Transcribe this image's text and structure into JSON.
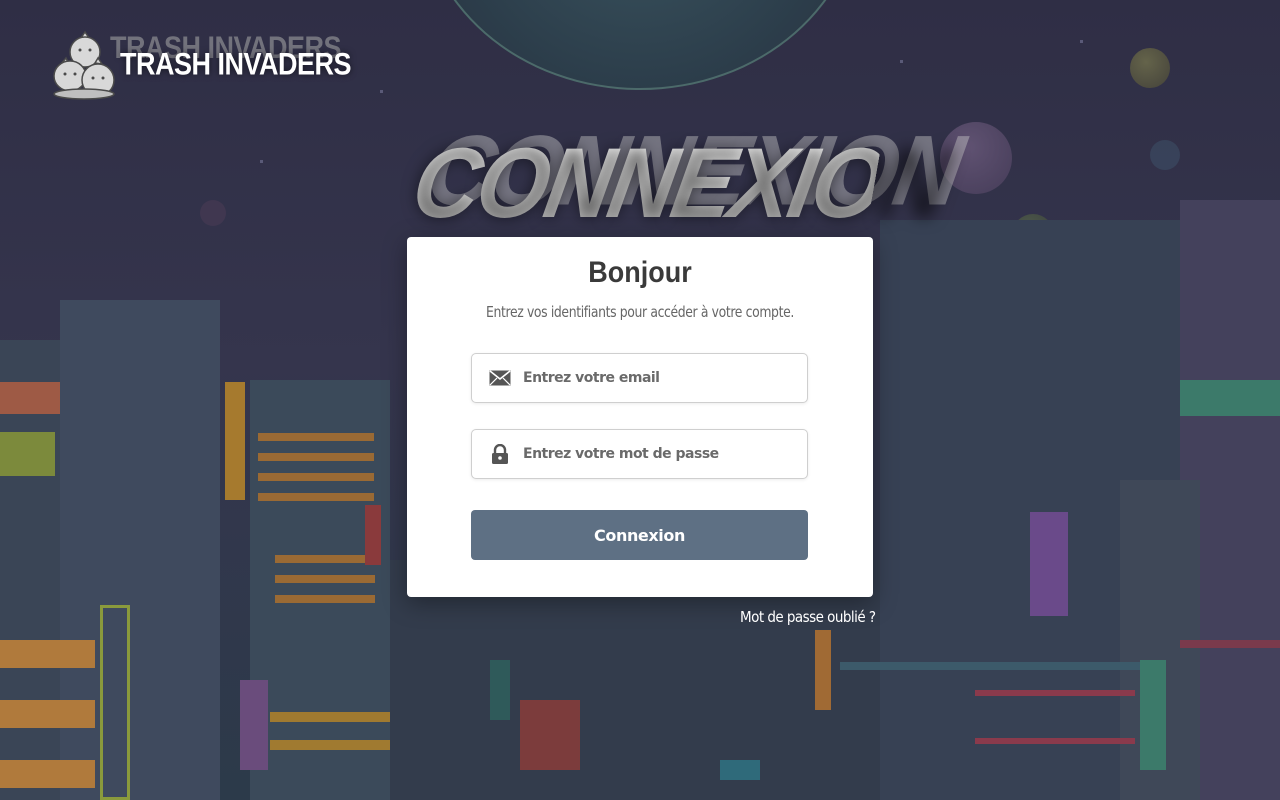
{
  "app": {
    "logo_text": "TRASH INVADERS"
  },
  "page": {
    "heading": "CONNEXION"
  },
  "login_card": {
    "title": "Bonjour",
    "subtitle": "Entrez vos identifiants pour accéder à votre compte.",
    "email": {
      "icon": "envelope-icon",
      "placeholder": "Entrez votre email",
      "value": ""
    },
    "password": {
      "icon": "lock-icon",
      "placeholder": "Entrez votre mot de passe",
      "value": ""
    },
    "submit_label": "Connexion"
  },
  "forgot_password_label": "Mot de passe oublié ?",
  "colors": {
    "button": "#5e7084",
    "background": "#33324a",
    "card": "#ffffff"
  }
}
